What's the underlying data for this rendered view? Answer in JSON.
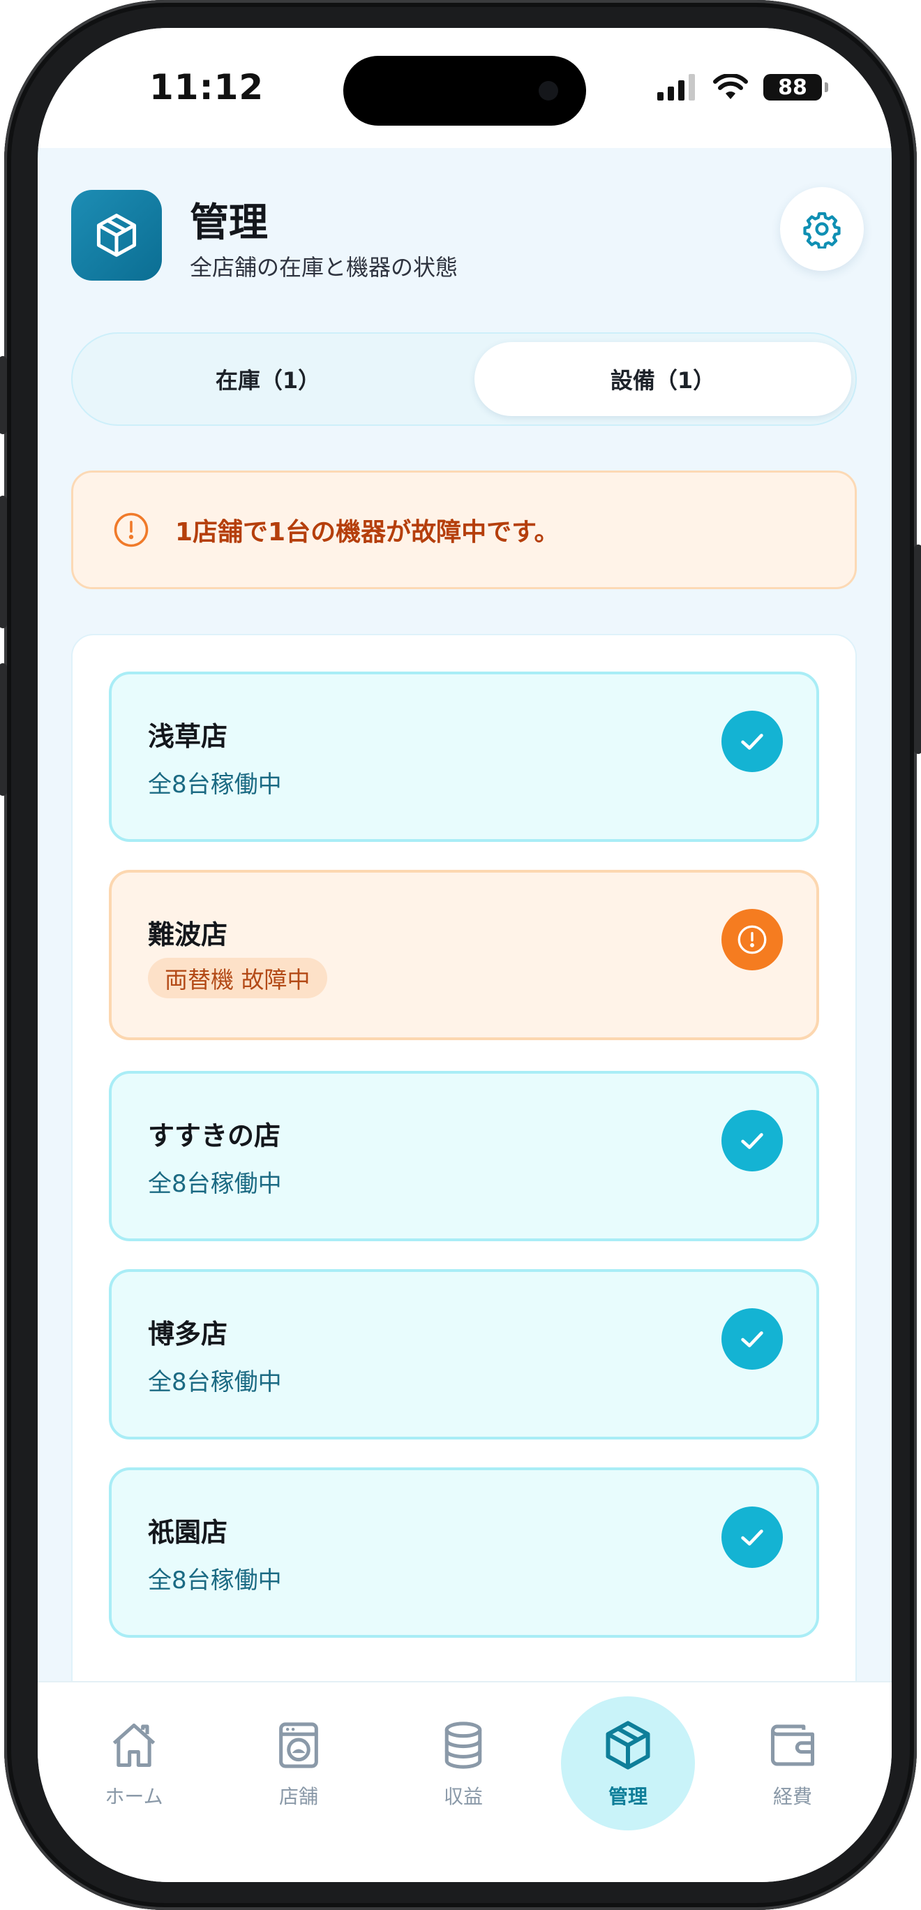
{
  "status_bar": {
    "time": "11:12",
    "battery": "88"
  },
  "header": {
    "title": "管理",
    "subtitle": "全店舗の在庫と機器の状態"
  },
  "tabs": [
    {
      "label": "在庫（1）",
      "selected": false
    },
    {
      "label": "設備（1）",
      "selected": true
    }
  ],
  "alert": {
    "text": "1店舗で1台の機器が故障中です。"
  },
  "stores": [
    {
      "name": "浅草店",
      "status": "全8台稼働中",
      "state": "ok"
    },
    {
      "name": "難波店",
      "status": "両替機 故障中",
      "state": "fault"
    },
    {
      "name": "すすきの店",
      "status": "全8台稼働中",
      "state": "ok"
    },
    {
      "name": "博多店",
      "status": "全8台稼働中",
      "state": "ok"
    },
    {
      "name": "祇園店",
      "status": "全8台稼働中",
      "state": "ok"
    }
  ],
  "bottom_nav": [
    {
      "label": "ホーム",
      "icon": "home-icon",
      "active": false
    },
    {
      "label": "店舗",
      "icon": "washing-machine-icon",
      "active": false
    },
    {
      "label": "収益",
      "icon": "coins-stack-icon",
      "active": false
    },
    {
      "label": "管理",
      "icon": "package-box-icon",
      "active": true
    },
    {
      "label": "経費",
      "icon": "wallet-icon",
      "active": false
    }
  ],
  "colors": {
    "accent": "#0e7e99",
    "ok": "#14b3d3",
    "warning": "#f57c20",
    "warning_text": "#b53f0c"
  }
}
